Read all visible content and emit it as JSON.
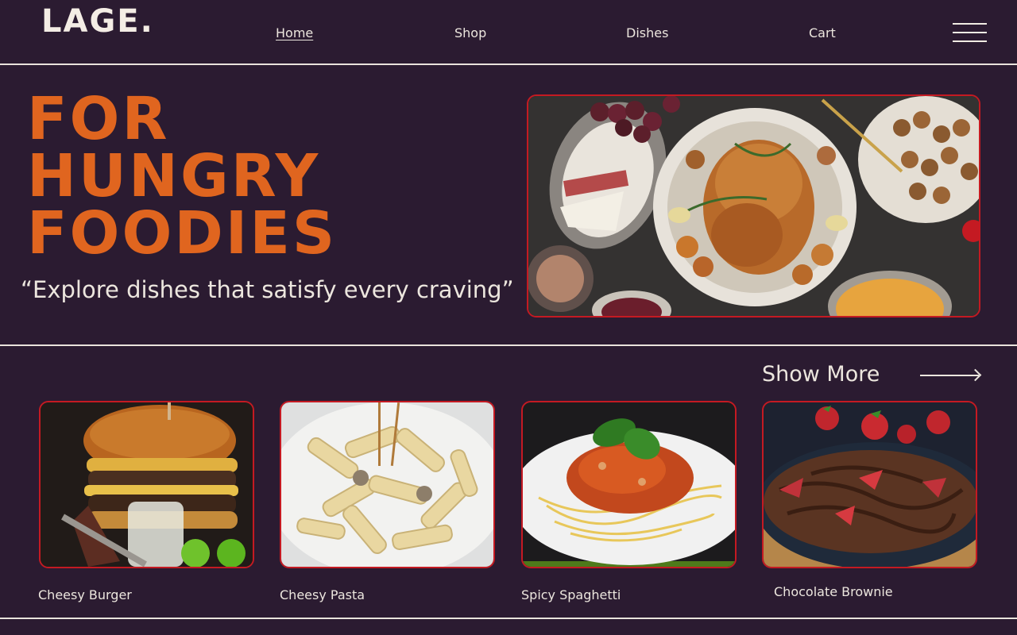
{
  "brand": {
    "logo": "LAGE."
  },
  "nav": {
    "items": [
      {
        "label": "Home",
        "active": true
      },
      {
        "label": "Shop",
        "active": false
      },
      {
        "label": "Dishes",
        "active": false
      },
      {
        "label": "Cart",
        "active": false
      }
    ],
    "menu_icon": "hamburger-menu-icon"
  },
  "hero": {
    "title_lines": [
      "FOR",
      "HUNGRY",
      "FOODIES"
    ],
    "quote": "“Explore dishes that satisfy every craving”",
    "image": "roast-chicken-feast"
  },
  "show_more": {
    "label": "Show More",
    "icon": "arrow-right-icon"
  },
  "dishes": [
    {
      "name": "Cheesy Burger",
      "image": "burger"
    },
    {
      "name": "Cheesy Pasta",
      "image": "penne-pasta"
    },
    {
      "name": "Spicy Spaghetti",
      "image": "spaghetti"
    },
    {
      "name": "Chocolate Brownie",
      "image": "brownie"
    }
  ],
  "colors": {
    "background": "#2b1b31",
    "accent_orange": "#e0651f",
    "card_border_red": "#c41a22",
    "text_light": "#ece6de"
  }
}
